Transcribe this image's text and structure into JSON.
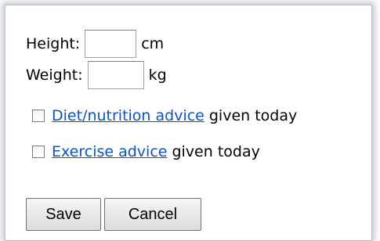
{
  "form": {
    "height": {
      "label": "Height:",
      "value": "",
      "unit": "cm"
    },
    "weight": {
      "label": "Weight:",
      "value": "",
      "unit": "kg"
    },
    "diet": {
      "checked": false,
      "link_text": "Diet/nutrition advice",
      "suffix": "given today"
    },
    "exercise": {
      "checked": false,
      "link_text": "Exercise advice",
      "suffix": "given today"
    }
  },
  "buttons": {
    "save_label": "Save",
    "cancel_label": "Cancel"
  },
  "colors": {
    "link": "#0a55c7",
    "frame_border": "#b9c2cc"
  }
}
